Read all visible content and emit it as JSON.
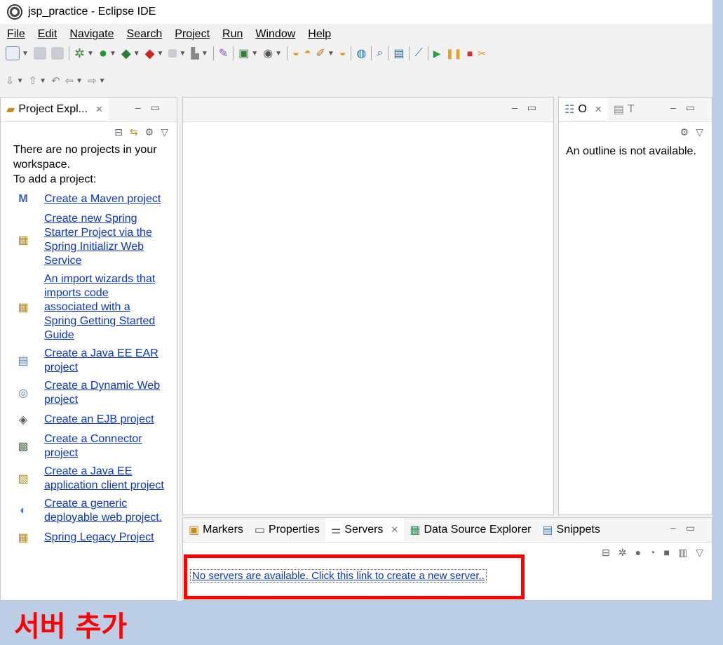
{
  "window": {
    "title": "jsp_practice - Eclipse IDE"
  },
  "menu": [
    "File",
    "Edit",
    "Navigate",
    "Search",
    "Project",
    "Run",
    "Window",
    "Help"
  ],
  "project_explorer": {
    "tab_label": "Project Expl...",
    "message_line1": "There are no projects in your workspace.",
    "message_line2": "To add a project:",
    "links": [
      {
        "label": "Create a Maven project",
        "icon": "maven-icon"
      },
      {
        "label": "Create new Spring Starter Project via the Spring Initializr Web Service",
        "icon": "spring-wizard-icon"
      },
      {
        "label": "An import wizards that imports code associated with a Spring Getting Started Guide",
        "icon": "spring-wizard-icon"
      },
      {
        "label": "Create a Java EE EAR project",
        "icon": "ear-icon"
      },
      {
        "label": "Create a Dynamic Web project",
        "icon": "web-project-icon"
      },
      {
        "label": "Create an EJB project",
        "icon": "ejb-icon"
      },
      {
        "label": "Create a Connector project",
        "icon": "connector-icon"
      },
      {
        "label": "Create a Java EE application client project",
        "icon": "app-client-icon"
      },
      {
        "label": "Create a generic deployable web project.",
        "icon": "generic-web-icon"
      },
      {
        "label": "Spring Legacy Project",
        "icon": "spring-wizard-icon"
      }
    ]
  },
  "outline": {
    "tab1": "O",
    "tab2": "T",
    "message": "An outline is not available."
  },
  "bottom_tabs": [
    {
      "label": "Markers",
      "active": false
    },
    {
      "label": "Properties",
      "active": false
    },
    {
      "label": "Servers",
      "active": true
    },
    {
      "label": "Data Source Explorer",
      "active": false
    },
    {
      "label": "Snippets",
      "active": false
    }
  ],
  "servers": {
    "empty_link": "No servers are available. Click this link to create a new server.."
  },
  "caption": "서버 추가"
}
